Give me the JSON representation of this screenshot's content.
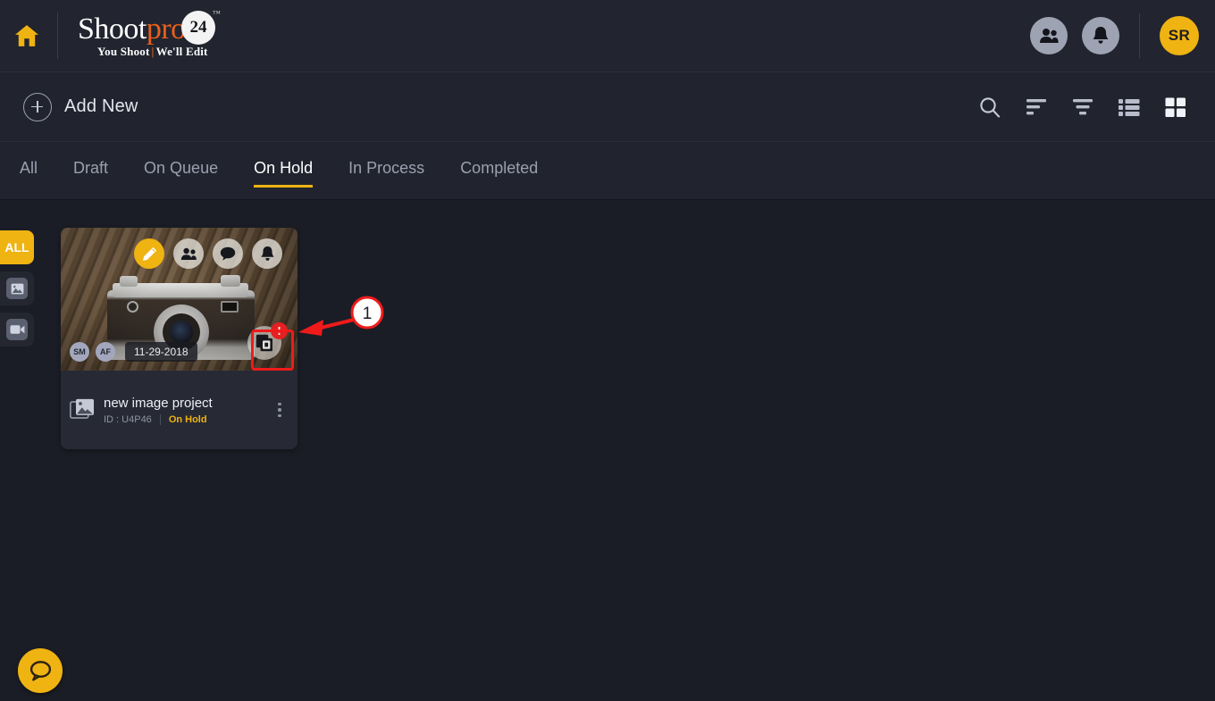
{
  "header": {
    "home_icon": "home-icon",
    "logo": {
      "word1": "Shoot",
      "word2": "pro",
      "badge": "24",
      "tm": "™",
      "tagline_left": "You Shoot",
      "tagline_sep": "|",
      "tagline_right": "We'll Edit"
    },
    "people_icon": "people-icon",
    "bell_icon": "bell-icon",
    "avatar_initials": "SR",
    "accent_color": "#efb312",
    "logo_orange": "#e8601c"
  },
  "toolbar": {
    "add_new_label": "Add New",
    "icons": [
      {
        "name": "search-icon"
      },
      {
        "name": "sort-icon"
      },
      {
        "name": "filter-icon"
      },
      {
        "name": "list-view-icon"
      },
      {
        "name": "grid-view-icon"
      }
    ]
  },
  "tabs": [
    {
      "label": "All",
      "active": false
    },
    {
      "label": "Draft",
      "active": false
    },
    {
      "label": "On Queue",
      "active": false
    },
    {
      "label": "On Hold",
      "active": true
    },
    {
      "label": "In Process",
      "active": false
    },
    {
      "label": "Completed",
      "active": false
    }
  ],
  "rail": [
    {
      "label": "ALL",
      "icon": "all-label",
      "active": true
    },
    {
      "label": "",
      "icon": "image-icon",
      "active": false
    },
    {
      "label": "",
      "icon": "video-icon",
      "active": false
    }
  ],
  "card": {
    "thumbnail_alt": "vintage-camera-on-wood",
    "actions": [
      {
        "name": "edit-icon"
      },
      {
        "name": "people-icon"
      },
      {
        "name": "comment-icon"
      },
      {
        "name": "bell-icon"
      }
    ],
    "members": [
      "SM",
      "AF"
    ],
    "date": "11-29-2018",
    "duplicate_icon": "duplicate-icon",
    "duplicate_badge": "!",
    "title": "new image project",
    "id_label": "ID : U4P46",
    "status": "On Hold",
    "status_color": "#efb312",
    "type_icon": "image-stack-icon",
    "kebab_icon": "more-vertical-icon"
  },
  "annotation": {
    "number": "1",
    "color": "#ef1b1b"
  },
  "fab": {
    "icon": "chat-icon",
    "color": "#efb312"
  }
}
